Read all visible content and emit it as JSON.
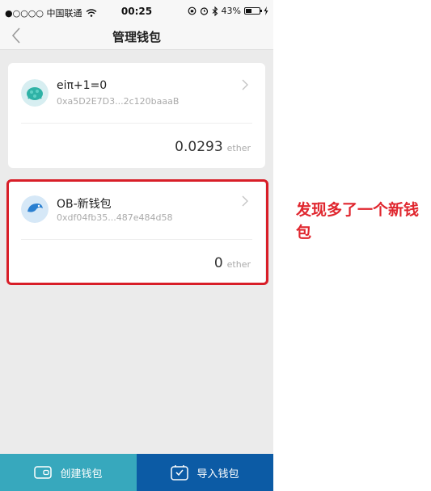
{
  "status_bar": {
    "carrier": "●○○○○ 中国联通",
    "time": "00:25",
    "battery": "43%",
    "battery_level": 0.43
  },
  "nav": {
    "title": "管理钱包"
  },
  "wallets": [
    {
      "name": "eiπ+1=0",
      "address": "0xa5D2E7D3...2c120baaaB",
      "balance": "0.0293",
      "unit": "ether"
    },
    {
      "name": "OB-新钱包",
      "address": "0xdf04fb35...487e484d58",
      "balance": "0",
      "unit": "ether"
    }
  ],
  "annotation": {
    "text": "发现多了一个新钱包"
  },
  "bottom": {
    "create_label": "创建钱包",
    "import_label": "导入钱包"
  },
  "colors": {
    "create_button": "#37a8bd",
    "import_button": "#0c5ba5",
    "highlight": "#d81e28",
    "annotation": "#e0262e"
  }
}
